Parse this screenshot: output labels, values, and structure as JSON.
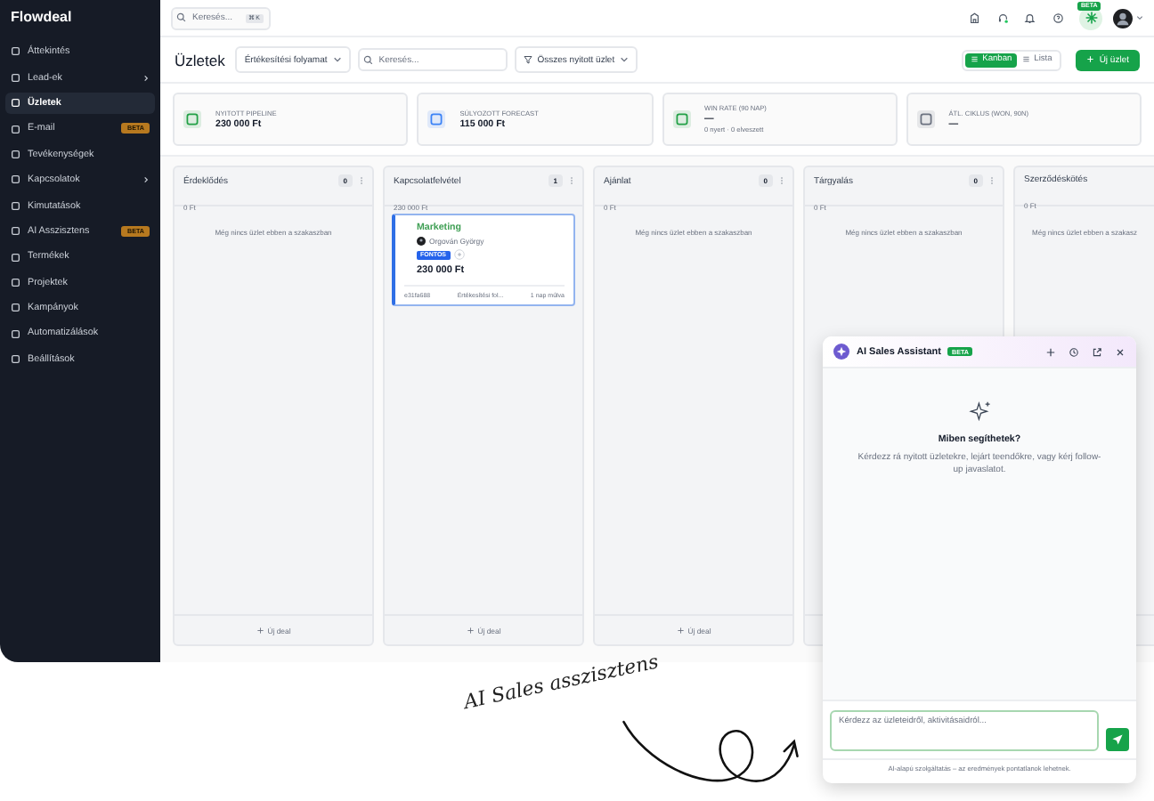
{
  "sidebar": {
    "logo": "Flowdeal",
    "items": [
      {
        "label": "Áttekintés",
        "selected": false
      },
      {
        "label": "Lead-ek",
        "selected": false,
        "expandable": true
      },
      {
        "label": "Üzletek",
        "selected": true
      },
      {
        "label": "E-mail",
        "selected": false,
        "badge": "BETA"
      },
      {
        "label": "Tevékenységek",
        "selected": false
      },
      {
        "label": "Kapcsolatok",
        "selected": false,
        "expandable": true
      },
      {
        "label": "Kimutatások",
        "selected": false
      },
      {
        "label": "AI Asszisztens",
        "selected": false,
        "badge": "BETA"
      },
      {
        "label": "Termékek",
        "selected": false
      },
      {
        "label": "Projektek",
        "selected": false
      },
      {
        "label": "Kampányok",
        "selected": false
      },
      {
        "label": "Automatizálások",
        "selected": false
      },
      {
        "label": "Beállítások",
        "selected": false
      }
    ]
  },
  "topbar": {
    "search": {
      "placeholder": "Keresés...",
      "shortcut": "⌘K"
    },
    "ai_badge": "BETA"
  },
  "header": {
    "title": "Üzletek",
    "pipeline_select": "Értékesítési folyamat",
    "search": {
      "placeholder": "Keresés..."
    },
    "filter": "Összes nyitott üzlet",
    "views": [
      {
        "label": "Kanban",
        "selected": true
      },
      {
        "label": "Lista",
        "selected": false
      }
    ],
    "new_button": "Új üzlet"
  },
  "stats": [
    {
      "label": "NYITOTT PIPELINE",
      "value": "230 000 Ft",
      "color": "#22a046"
    },
    {
      "label": "SÚLYOZOTT FORECAST",
      "value": "115 000 Ft",
      "color": "#3b82f6"
    },
    {
      "label": "WIN RATE (90 NAP)",
      "value": "—",
      "sub": "0 nyert · 0 elveszett",
      "color": "#22a046"
    },
    {
      "label": "ÁTL. CIKLUS (WON, 90N)",
      "value": "—",
      "color": "#6b7280"
    }
  ],
  "columns": [
    {
      "name": "Érdeklődés",
      "amount": "0 Ft",
      "count": "0",
      "empty": "Még nincs üzlet ebben a szakaszban",
      "add": "Új deal"
    },
    {
      "name": "Kapcsolatfelvétel",
      "amount": "230 000 Ft",
      "count": "1",
      "cards": [
        {
          "title": "Marketing",
          "contact": "Orgován György",
          "tag": "FONTOS",
          "amount": "230 000 Ft",
          "id": "e31fa688",
          "pipeline": "Értékesítési fol...",
          "due": "1 nap múlva"
        }
      ],
      "add": "Új deal"
    },
    {
      "name": "Ajánlat",
      "amount": "0 Ft",
      "count": "0",
      "empty": "Még nincs üzlet ebben a szakaszban",
      "add": "Új deal"
    },
    {
      "name": "Tárgyalás",
      "amount": "0 Ft",
      "count": "0",
      "empty": "Még nincs üzlet ebben a szakaszban"
    },
    {
      "name": "Szerződéskötés",
      "amount": "0 Ft",
      "empty": "Még nincs üzlet ebben a szakasz"
    }
  ],
  "chat": {
    "title": "AI Sales Assistant",
    "badge": "BETA",
    "heading": "Miben segíthetek?",
    "text": "Kérdezz rá nyitott üzletekre, lejárt teendőkre, vagy kérj follow-up javaslatot.",
    "input": {
      "placeholder": "Kérdezz az üzleteidről, aktivitásaidról..."
    },
    "footer": "AI-alapú szolgáltatás – az eredmények pontatlanok lehetnek."
  },
  "annotation": "AI Sales asszisztens"
}
